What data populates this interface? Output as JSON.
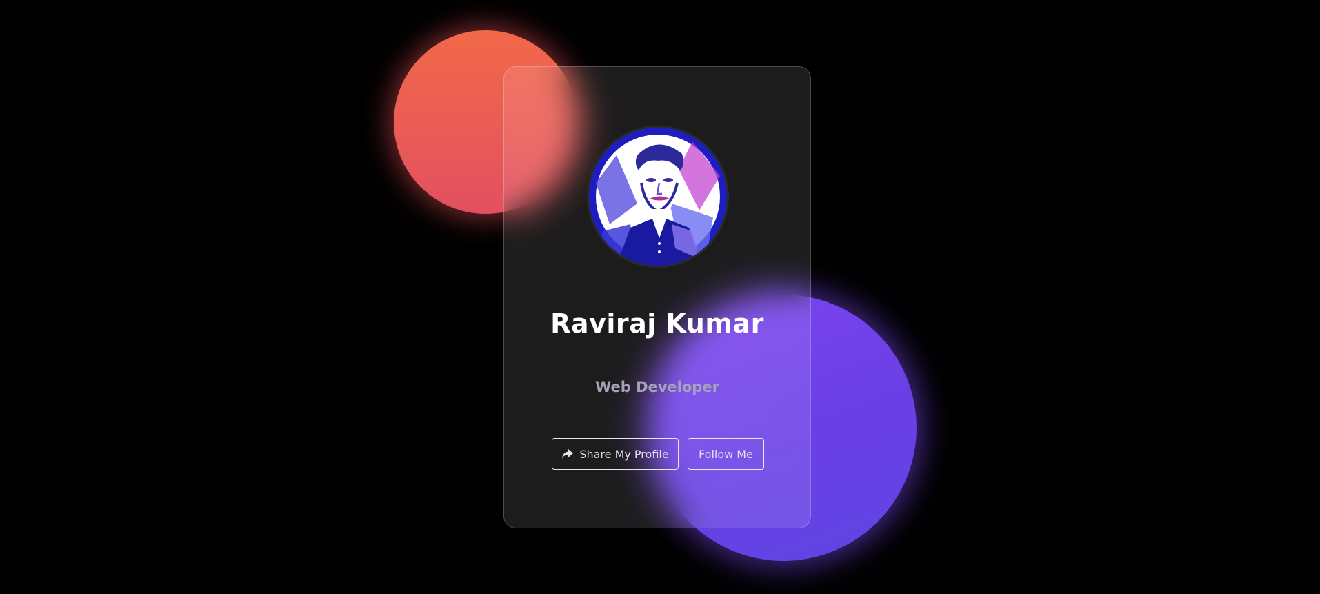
{
  "profile": {
    "name": "Raviraj Kumar",
    "role": "Web Developer",
    "avatar_icon": "portrait-avatar"
  },
  "actions": {
    "share_label": "Share My Profile",
    "share_icon": "share-arrow-icon",
    "follow_label": "Follow Me"
  },
  "colors": {
    "background": "#000000",
    "orange_blob": "#f2694a",
    "purple_blob": "#7c43ee",
    "name_text": "#ffffff",
    "role_text": "#a7a1b7",
    "button_border": "#e8e8ee"
  }
}
